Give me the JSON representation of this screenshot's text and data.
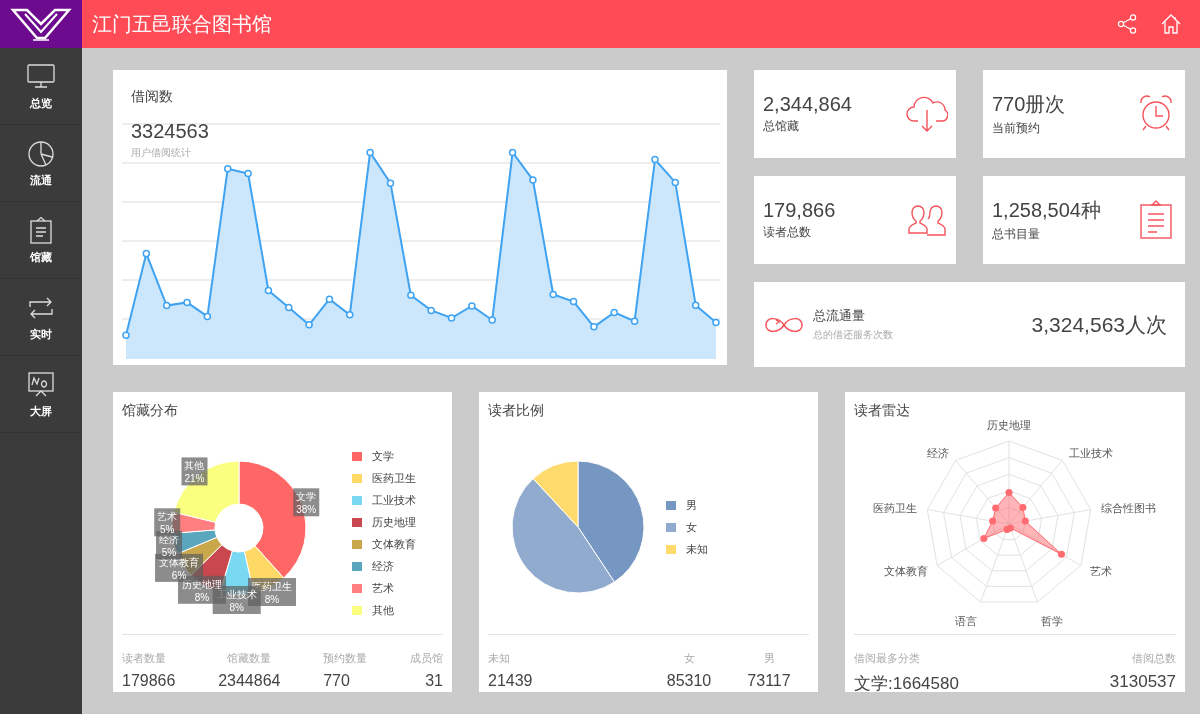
{
  "header": {
    "title": "江门五邑联合图书馆"
  },
  "sidebar": {
    "items": [
      {
        "label": "总览"
      },
      {
        "label": "流通"
      },
      {
        "label": "馆藏"
      },
      {
        "label": "实时"
      },
      {
        "label": "大屏"
      }
    ]
  },
  "borrow_card": {
    "title": "借阅数",
    "value": "3324563",
    "caption": "用户借阅统计"
  },
  "stats": [
    {
      "value": "2,344,864",
      "label": "总馆藏"
    },
    {
      "value": "770册次",
      "label": "当前预约"
    },
    {
      "value": "179,866",
      "label": "读者总数"
    },
    {
      "value": "1,258,504种",
      "label": "总书目量"
    }
  ],
  "flow": {
    "title": "总流通量",
    "caption": "总的借还服务次数",
    "value": "3,324,563人次"
  },
  "collection": {
    "title": "馆藏分布",
    "chart_data": {
      "type": "donut",
      "categories": [
        "文学",
        "医药卫生",
        "工业技术",
        "历史地理",
        "文体教育",
        "经济",
        "艺术",
        "其他"
      ],
      "values": [
        38,
        8,
        8,
        8,
        6,
        5,
        5,
        21
      ],
      "value_labels": [
        "38%",
        "8%",
        "8%",
        "8%",
        "6%",
        "5%",
        "5%",
        "21%"
      ]
    },
    "legend": [
      {
        "label": "文学",
        "color": "#ff6666"
      },
      {
        "label": "医药卫生",
        "color": "#ffd966"
      },
      {
        "label": "工业技术",
        "color": "#7ad9f2"
      },
      {
        "label": "历史地理",
        "color": "#c9474e"
      },
      {
        "label": "文体教育",
        "color": "#c9a84c"
      },
      {
        "label": "经济",
        "color": "#5aa6bd"
      },
      {
        "label": "艺术",
        "color": "#ff7f80"
      },
      {
        "label": "其他",
        "color": "#fbff80"
      }
    ],
    "footer": [
      {
        "label": "读者数量",
        "value": "179866"
      },
      {
        "label": "馆藏数量",
        "value": "2344864"
      },
      {
        "label": "预约数量",
        "value": "770"
      },
      {
        "label": "成员馆",
        "value": "31"
      }
    ]
  },
  "readers": {
    "title": "读者比例",
    "chart_data": {
      "type": "pie",
      "values": [
        40.7,
        47.4,
        11.9
      ]
    },
    "legend": [
      {
        "label": "男",
        "color": "#7597c2"
      },
      {
        "label": "女",
        "color": "#91abcf"
      },
      {
        "label": "未知",
        "color": "#ffdb6e"
      }
    ],
    "footer": [
      {
        "label": "未知",
        "value": "21439"
      },
      {
        "label": "女",
        "value": "85310"
      },
      {
        "label": "男",
        "value": "73117"
      }
    ]
  },
  "radar": {
    "title": "读者雷达",
    "axes": [
      "历史地理",
      "工业技术",
      "综合性图书",
      "艺术",
      "哲学",
      "语言",
      "文体教育",
      "医药卫生",
      "经济"
    ],
    "footer": [
      {
        "label": "借阅最多分类",
        "value": "文学:1664580"
      },
      {
        "label": "借阅总数",
        "value": "3130537"
      }
    ]
  }
}
